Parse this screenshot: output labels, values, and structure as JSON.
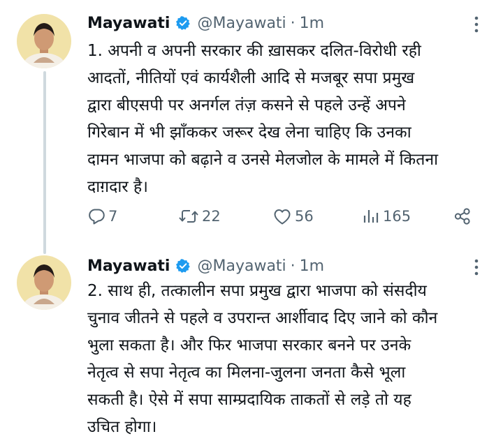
{
  "thread": [
    {
      "author": {
        "name": "Mayawati",
        "handle": "@Mayawati",
        "verified": true
      },
      "separator": "·",
      "time": "1m",
      "lines": [
        "1. अपनी व अपनी सरकार की ख़ासकर दलित-विरोधी रही",
        "आदतों, नीतियों एवं कार्यशैली आदि से मजबूर सपा प्रमुख",
        "द्वारा बीएसपी पर अनर्गल तंज़ कसने से पहले उन्हें अपने",
        "गिरेबान में भी झाँककर जरूर देख लेना चाहिए कि उनका",
        "दामन भाजपा को बढ़ाने व उनसे मेलजोल के मामले में कितना",
        "दाग़दार है।"
      ],
      "stats": {
        "replies": "7",
        "retweets": "22",
        "likes": "56",
        "views": "165"
      }
    },
    {
      "author": {
        "name": "Mayawati",
        "handle": "@Mayawati",
        "verified": true
      },
      "separator": "·",
      "time": "1m",
      "lines": [
        "2. साथ ही, तत्कालीन सपा प्रमुख द्वारा भाजपा को संसदीय",
        "चुनाव जीतने से पहले व उपरान्त आर्शीवाद दिए जाने को कौन",
        "भुला सकता है। और फिर भाजपा सरकार बनने पर उनके",
        "नेतृत्व से सपा नेतृत्व का मिलना-जुलना जनता कैसे भूला",
        "सकती है। ऐसे में सपा साम्प्रदायिक ताकतों से लड़े तो यह",
        "उचित होगा।"
      ]
    }
  ],
  "icons": {
    "verified": "verified-badge-icon",
    "more": "more-options-icon",
    "reply": "reply-icon",
    "retweet": "retweet-icon",
    "like": "like-icon",
    "views": "views-icon",
    "share": "share-icon"
  },
  "colors": {
    "text": "#0f1419",
    "secondary": "#536471",
    "verified": "#1d9bf0",
    "thread_line": "#cfd9de",
    "background": "#ffffff"
  }
}
